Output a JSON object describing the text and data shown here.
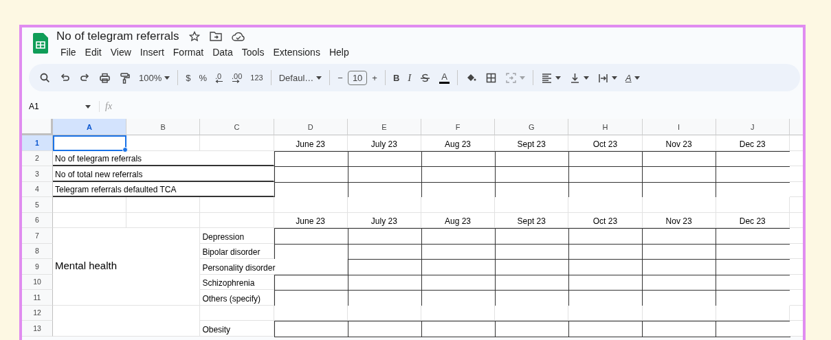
{
  "document": {
    "title": "No of telegram referrals"
  },
  "menu": [
    "File",
    "Edit",
    "View",
    "Insert",
    "Format",
    "Data",
    "Tools",
    "Extensions",
    "Help"
  ],
  "toolbar": [
    {
      "kind": "search"
    },
    {
      "kind": "undo"
    },
    {
      "kind": "redo"
    },
    {
      "kind": "print"
    },
    {
      "kind": "paint"
    },
    {
      "kind": "dropdown",
      "text": "100%"
    },
    {
      "kind": "sep"
    },
    {
      "kind": "text",
      "text": "$"
    },
    {
      "kind": "text",
      "text": "%"
    },
    {
      "kind": "decrease",
      "text": ".0"
    },
    {
      "kind": "increase",
      "text": ".00"
    },
    {
      "kind": "text",
      "text": "123"
    },
    {
      "kind": "sep"
    },
    {
      "kind": "dropdown",
      "text": "Defaul…"
    },
    {
      "kind": "sep"
    },
    {
      "kind": "text",
      "text": "−"
    },
    {
      "kind": "field",
      "text": "10"
    },
    {
      "kind": "text",
      "text": "+"
    },
    {
      "kind": "sep"
    },
    {
      "kind": "bold",
      "text": "B"
    },
    {
      "kind": "italic",
      "text": "I"
    },
    {
      "kind": "strike"
    },
    {
      "kind": "color",
      "text": "A"
    },
    {
      "kind": "sep"
    },
    {
      "kind": "fill"
    },
    {
      "kind": "borders"
    },
    {
      "kind": "merge",
      "disabled": true
    },
    {
      "kind": "sep"
    },
    {
      "kind": "align"
    },
    {
      "kind": "valign"
    },
    {
      "kind": "wrap"
    },
    {
      "kind": "rotate",
      "text": "A"
    }
  ],
  "formula_bar": {
    "cell": "A1",
    "fx": "fx"
  },
  "sheet": {
    "columns": [
      {
        "label": "A",
        "selected": true
      },
      {
        "label": "B",
        "selected": false
      },
      {
        "label": "C",
        "selected": false
      },
      {
        "label": "D",
        "selected": false
      },
      {
        "label": "E",
        "selected": false
      },
      {
        "label": "F",
        "selected": false
      },
      {
        "label": "G",
        "selected": false
      },
      {
        "label": "H",
        "selected": false
      },
      {
        "label": "I",
        "selected": false
      },
      {
        "label": "J",
        "selected": false
      }
    ],
    "rows": [
      {
        "number": "1",
        "selected": true
      },
      {
        "number": "2",
        "selected": false
      },
      {
        "number": "3",
        "selected": false
      },
      {
        "number": "4",
        "selected": false
      },
      {
        "number": "5",
        "selected": false
      },
      {
        "number": "6",
        "selected": false
      },
      {
        "number": "7",
        "selected": false
      },
      {
        "number": "8",
        "selected": false
      },
      {
        "number": "9",
        "selected": false
      },
      {
        "number": "10",
        "selected": false
      },
      {
        "number": "11",
        "selected": false
      },
      {
        "number": "12",
        "selected": false
      },
      {
        "number": "13",
        "selected": false
      }
    ],
    "sections": [
      {
        "kind": "months",
        "months": [
          "June 23",
          "July 23",
          "Aug 23",
          "Sept 23",
          "Oct 23",
          "Nov 23",
          "Dec 23"
        ]
      },
      {
        "kind": "metric",
        "label": "No of telegram referrals"
      },
      {
        "kind": "metric",
        "label": "No of total new referrals"
      },
      {
        "kind": "metric",
        "label": "Telegram referrals defaulted TCA"
      },
      {
        "kind": "blank"
      },
      {
        "kind": "months",
        "months": [
          "June 23",
          "July 23",
          "Aug 23",
          "Sept 23",
          "Oct 23",
          "Nov 23",
          "Dec 23"
        ]
      },
      {
        "kind": "group",
        "label": "Mental health",
        "items": [
          {
            "kind": "item",
            "label": "Depression"
          },
          {
            "kind": "item",
            "label": "Bipolar disorder"
          },
          {
            "kind": "long",
            "label": "Personality disorder"
          },
          {
            "kind": "item",
            "label": "Schizophrenia"
          },
          {
            "kind": "item",
            "label": "Others (specify)"
          }
        ]
      },
      {
        "kind": "group",
        "items": [
          {
            "kind": "blank"
          },
          {
            "kind": "item",
            "label": "Obesity"
          }
        ]
      }
    ]
  }
}
